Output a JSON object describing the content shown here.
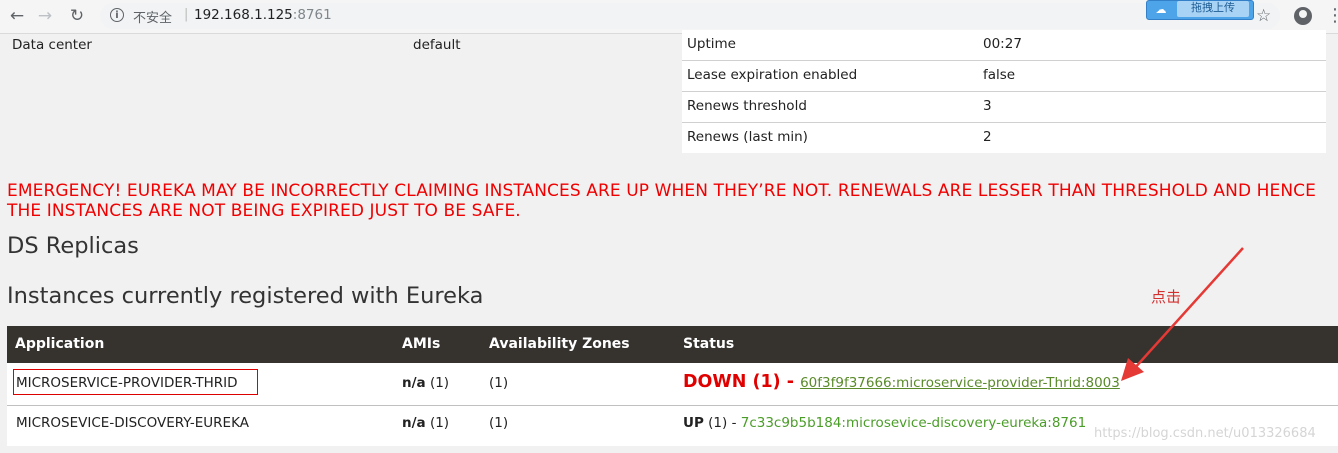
{
  "browser": {
    "security_label": "不安全",
    "url_host": "192.168.1.125",
    "url_port": ":8761",
    "extension_label": "拖拽上传"
  },
  "general_info": {
    "left": [
      {
        "label": "Data center",
        "value": "default"
      }
    ],
    "right": [
      {
        "label": "Uptime",
        "value": "00:27"
      },
      {
        "label": "Lease expiration enabled",
        "value": "false"
      },
      {
        "label": "Renews threshold",
        "value": "3"
      },
      {
        "label": "Renews (last min)",
        "value": "2"
      }
    ]
  },
  "emergency_message": "EMERGENCY! EUREKA MAY BE INCORRECTLY CLAIMING INSTANCES ARE UP WHEN THEY’RE NOT. RENEWALS ARE LESSER THAN THRESHOLD AND HENCE THE INSTANCES ARE NOT BEING EXPIRED JUST TO BE SAFE.",
  "replicas_heading": "DS Replicas",
  "instances_heading": "Instances currently registered with Eureka",
  "table": {
    "headers": [
      "Application",
      "AMIs",
      "Availability Zones",
      "Status"
    ],
    "rows": [
      {
        "application": "MICROSERVICE-PROVIDER-THRID",
        "amis_value": "n/a",
        "amis_count": " (1)",
        "zones": "(1)",
        "status_state": "DOWN (1)",
        "status_sep": " - ",
        "instance_link": "60f3f9f37666:microservice-provider-Thrid:8003"
      },
      {
        "application": "MICROSEVICE-DISCOVERY-EUREKA",
        "amis_value": "n/a",
        "amis_count": " (1)",
        "zones": "(1)",
        "status_state": "UP",
        "status_count": " (1) - ",
        "instance_link": "7c33c9b5b184:microsevice-discovery-eureka:8761"
      }
    ]
  },
  "annotation": {
    "note": "点击",
    "color": "#e53935"
  },
  "watermark": "https://blog.csdn.net/u013326684"
}
